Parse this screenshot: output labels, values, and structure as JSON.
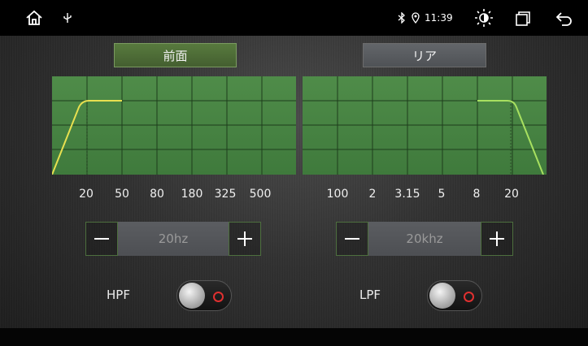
{
  "status_bar": {
    "icons": [
      "home-icon",
      "usb-icon",
      "bluetooth-icon",
      "location-icon",
      "brightness-icon",
      "recent-apps-icon",
      "back-icon"
    ],
    "time": "11:39"
  },
  "tabs": {
    "front": "前面",
    "rear": "リア"
  },
  "front": {
    "freq_labels": [
      "20",
      "50",
      "80",
      "180",
      "325",
      "500"
    ],
    "value": "20hz",
    "filter_label": "HPF"
  },
  "rear": {
    "freq_labels": [
      "100",
      "2",
      "3.15",
      "5",
      "8",
      "20"
    ],
    "value": "20khz",
    "filter_label": "LPF"
  },
  "stepper": {
    "minus": "−",
    "plus": "+"
  },
  "colors": {
    "graph_green": "#4f8c49",
    "hpf_curve": "#e8e050",
    "lpf_curve": "#a8e060",
    "toggle_ring": "#e03030"
  }
}
